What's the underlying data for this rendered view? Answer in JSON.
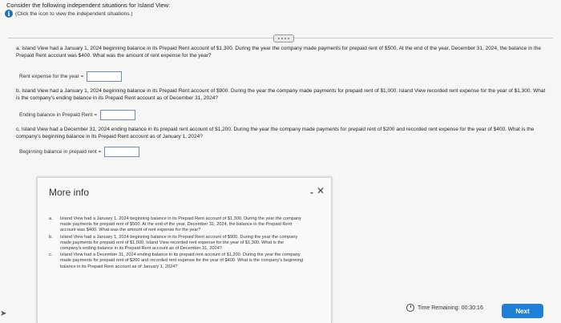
{
  "intro": {
    "title": "Consider the following independent situations for Island View:",
    "subtitle": "(Click the icon to view the independent situations.)"
  },
  "questions": {
    "a": {
      "text": "a. Island View had a January 1, 2024 beginning balance in its Prepaid Rent account of $1,300. During the year the company made payments for prepaid rent of $500. At the end of the year, December 31, 2024, the balance in the Prepaid Rent account was $400. What was the amount of rent expense for the year?",
      "label": "Rent expense for the year ="
    },
    "b": {
      "text": "b. Island View had a January 1, 2024 beginning balance in its Prepaid Rent account of $900. During the year the company made payments for prepaid rent of $1,000. Island View recorded rent expense for the year of $1,300. What is the company's ending balance in its Prepaid Rent account as of December 31, 2024?",
      "label": "Ending balance in Prepaid Rent ="
    },
    "c": {
      "text": "c. Island View had a December 31, 2024 ending balance in its prepaid rent account of $1,200. During the year the company made payments for prepaid rent of $200 and recorded rent expense for the year of $400. What is the company's beginning balance in its Prepaid Rent account as of January 1, 2024?",
      "label": "Beginning balance in prepaid rent ="
    }
  },
  "panel": {
    "title": "More info",
    "minimize": "-",
    "close": "✕",
    "items": [
      {
        "letter": "a.",
        "text": "Island View had a January 1, 2024 beginning balance in its Prepaid Rent account of $1,300. During the year the company made payments for prepaid rent of $500. At the end of the year, December 31, 2024, the balance in the Prepaid Rent account was $400. What was the amount of rent expense for the year?"
      },
      {
        "letter": "b.",
        "text": "Island View had a January 1, 2024 beginning balance in its Prepaid Rent account of $900. During the year the company made payments for prepaid rent of $1,000. Island View recorded rent expense for the year of $1,300. What is the company's ending balance in its Prepaid Rent account as of December 31, 2024?"
      },
      {
        "letter": "c.",
        "text": "Island View had a December 31, 2024 ending balance in its prepaid rent account of $1,200. During the year the company made payments for prepaid rent of $200 and recorded rent expense for the year of $400. What is the company's beginning balance in its Prepaid Rent account as of January 1, 2024?"
      }
    ]
  },
  "footer": {
    "timer": "Time Remaining: 00:30:16",
    "next": "Next"
  },
  "colors": {
    "accent": "#1f7fd6",
    "info_icon": "#1f6fb2"
  },
  "icons": {
    "info": "info-icon",
    "clock": "clock-icon",
    "handle": "drag-handle-icon"
  }
}
